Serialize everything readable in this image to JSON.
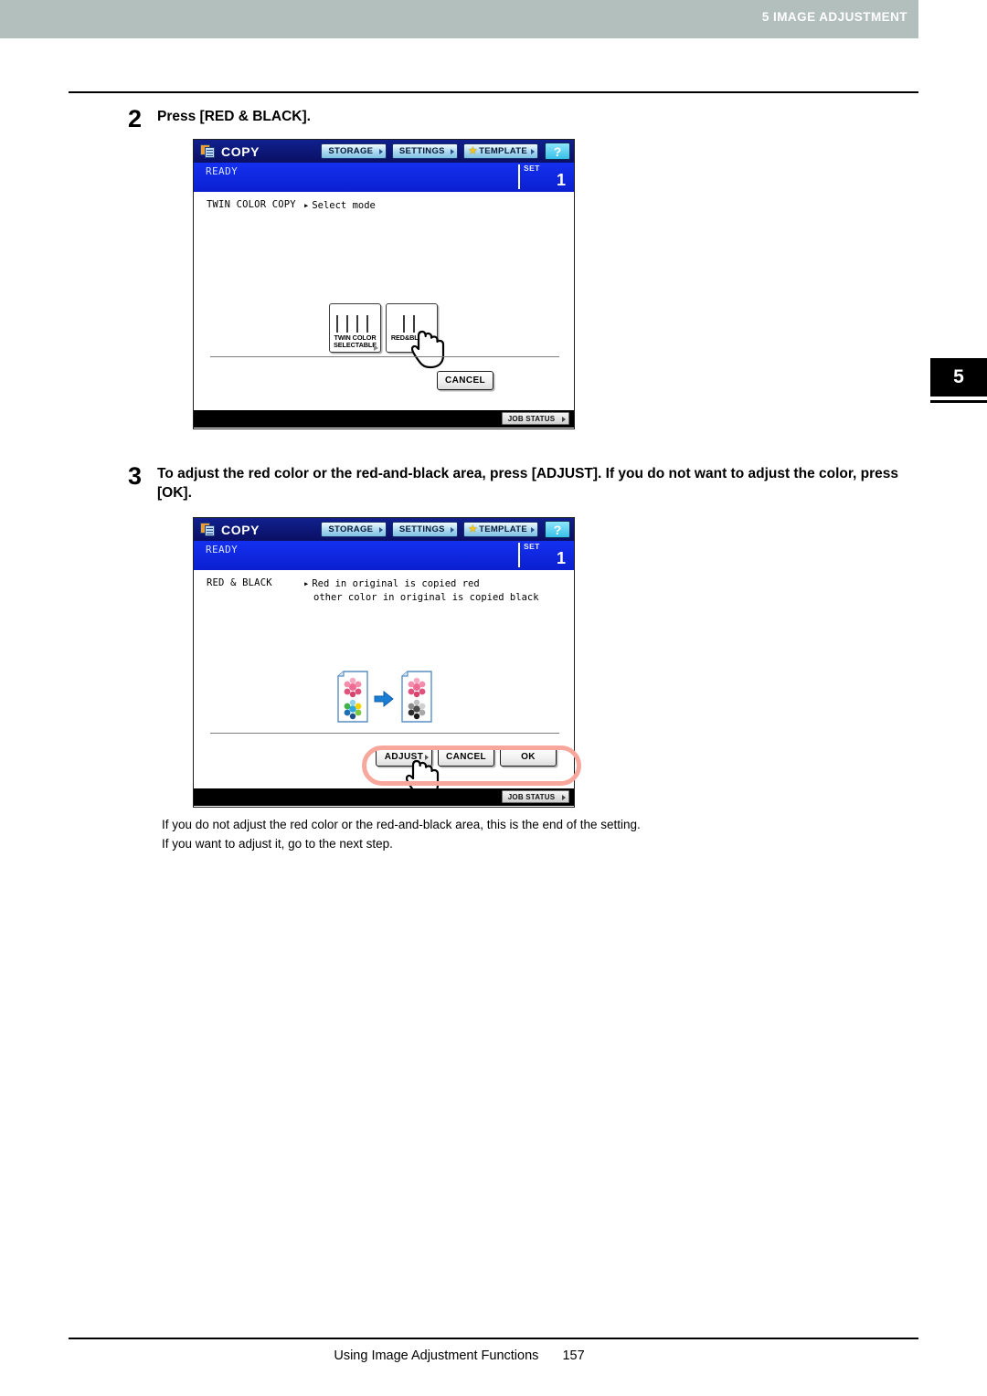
{
  "header": {
    "chapter_number": "5",
    "chapter_title": "5 IMAGE ADJUSTMENT",
    "tab_number": "5",
    "band_color": "#b3bfbd"
  },
  "steps": [
    {
      "number": "2",
      "text": "Press [RED & BLACK]."
    },
    {
      "number": "3",
      "text": "To adjust the red color or the red-and-black area, press [ADJUST]. If you do not want to adjust the color, press [OK]."
    }
  ],
  "panel1": {
    "app_name": "COPY",
    "app_icon": "copy-documents-icon",
    "toolbar": [
      {
        "label": "STORAGE",
        "icon": ""
      },
      {
        "label": "SETTINGS",
        "icon": ""
      },
      {
        "label": "TEMPLATE",
        "icon": "star-icon"
      }
    ],
    "help_label": "?",
    "status": "READY",
    "set_label": "SET",
    "set_value": "1",
    "mode_title": "TWIN COLOR COPY",
    "mode_desc": "Select mode",
    "mode_buttons": [
      {
        "caption_line1": "TWIN COLOR",
        "caption_line2": "SELECTABLE",
        "toner_colors": [
          "#f2d400",
          "#e5168e",
          "#00a8e0",
          "#1c1c1c"
        ],
        "has_arrow": true
      },
      {
        "caption_line1": "RED&BLACK",
        "caption_line2": "",
        "toner_colors": [
          "#e51c1c",
          "#1c1c1c"
        ],
        "has_arrow": false
      }
    ],
    "cancel_label": "CANCEL",
    "job_status_label": "JOB STATUS",
    "cursor": "pointing-hand-cursor"
  },
  "panel2": {
    "app_name": "COPY",
    "app_icon": "copy-documents-icon",
    "toolbar": [
      {
        "label": "STORAGE",
        "icon": ""
      },
      {
        "label": "SETTINGS",
        "icon": ""
      },
      {
        "label": "TEMPLATE",
        "icon": "star-icon"
      }
    ],
    "help_label": "?",
    "status": "READY",
    "set_label": "SET",
    "set_value": "1",
    "mode_title": "RED & BLACK",
    "desc_line1": "Red in original is copied red",
    "desc_line2": "other color in original is copied black",
    "preview": {
      "source_icon": "color-document-icon",
      "arrow_icon": "right-arrow-icon",
      "result_icon": "red-black-document-icon"
    },
    "buttons": [
      {
        "label": "ADJUST",
        "has_arrow": true
      },
      {
        "label": "CANCEL",
        "has_arrow": false
      },
      {
        "label": "OK",
        "has_arrow": false
      }
    ],
    "job_status_label": "JOB STATUS",
    "highlight_color": "#f7a79b",
    "cursor": "pointing-hand-cursor"
  },
  "note": {
    "line1": "If you do not adjust the red color or the red-and-black area, this is the end of the setting.",
    "line2": "If you want to adjust it, go to the next step."
  },
  "footer": {
    "title": "Using Image Adjustment Functions",
    "page_number": "157"
  }
}
